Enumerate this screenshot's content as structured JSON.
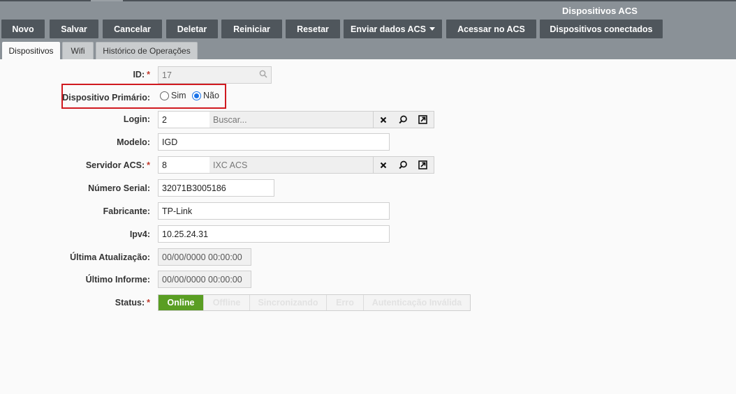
{
  "window": {
    "title": "Dispositivos ACS"
  },
  "toolbar": {
    "novo": "Novo",
    "salvar": "Salvar",
    "cancelar": "Cancelar",
    "deletar": "Deletar",
    "reiniciar": "Reiniciar",
    "resetar": "Resetar",
    "enviar": "Enviar dados ACS",
    "acessar": "Acessar no ACS",
    "conectados": "Dispositivos conectados"
  },
  "tabs": [
    "Dispositivos",
    "Wifi",
    "Histórico de Operações"
  ],
  "form": {
    "id": {
      "label": "ID:",
      "value": "17"
    },
    "primario": {
      "label": "Dispositivo Primário:",
      "sim": "Sim",
      "nao": "Não",
      "selected": "Não"
    },
    "login": {
      "label": "Login:",
      "value": "2",
      "placeholder": "Buscar..."
    },
    "modelo": {
      "label": "Modelo:",
      "value": "IGD"
    },
    "servidor": {
      "label": "Servidor ACS:",
      "value": "8",
      "display": "IXC ACS"
    },
    "serial": {
      "label": "Número Serial:",
      "value": "32071B3005186"
    },
    "fabricante": {
      "label": "Fabricante:",
      "value": "TP-Link"
    },
    "ipv4": {
      "label": "Ipv4:",
      "value": "10.25.24.31"
    },
    "ultima_atualizacao": {
      "label": "Última Atualização:",
      "value": "00/00/0000 00:00:00"
    },
    "ultimo_informe": {
      "label": "Último Informe:",
      "value": "00/00/0000 00:00:00"
    },
    "status": {
      "label": "Status:",
      "options": [
        "Online",
        "Offline",
        "Sincronizando",
        "Erro",
        "Autenticação Inválida"
      ],
      "selected": "Online"
    }
  },
  "required_mark": "*",
  "icons": {
    "search": "search-icon",
    "clear": "close-icon",
    "open": "external-link-icon"
  },
  "colors": {
    "toolbar_bg": "#4f565c",
    "header_bg": "#8a9197",
    "status_active": "#5a9e23",
    "highlight": "#d0191f",
    "required": "#c0392b"
  }
}
